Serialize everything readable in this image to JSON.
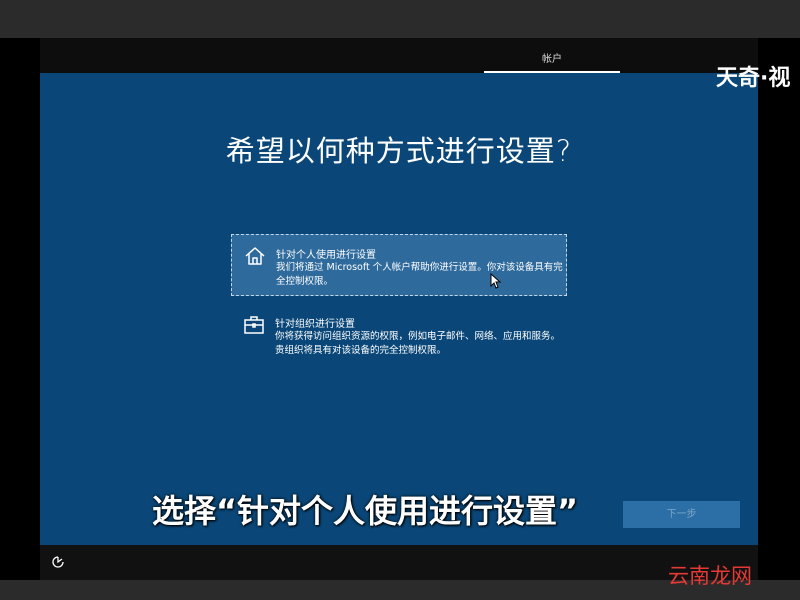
{
  "header": {
    "step_label": "帐户"
  },
  "main": {
    "question": "希望以何种方式进行设置?",
    "options": [
      {
        "icon": "home-icon",
        "title": "针对个人使用进行设置",
        "description": "我们将通过 Microsoft 个人帐户帮助你进行设置。你对该设备具有完全控制权限。",
        "selected": true
      },
      {
        "icon": "briefcase-icon",
        "title": "针对组织进行设置",
        "description": "你将获得访问组织资源的权限，例如电子邮件、网络、应用和服务。贵组织将具有对该设备的完全控制权限。",
        "selected": false
      }
    ],
    "next_label": "下一步"
  },
  "overlay": {
    "subtitle": "选择“针对个人使用进行设置”"
  },
  "footer": {
    "icon": "accessibility-icon"
  },
  "watermarks": {
    "top_right": "天奇·视",
    "bottom_right": "云南龙网"
  },
  "colors": {
    "background": "#0a4778",
    "selected_option": "#2e6a9c",
    "next_button": "#2b6fa6",
    "header": "#0d0d0d"
  }
}
